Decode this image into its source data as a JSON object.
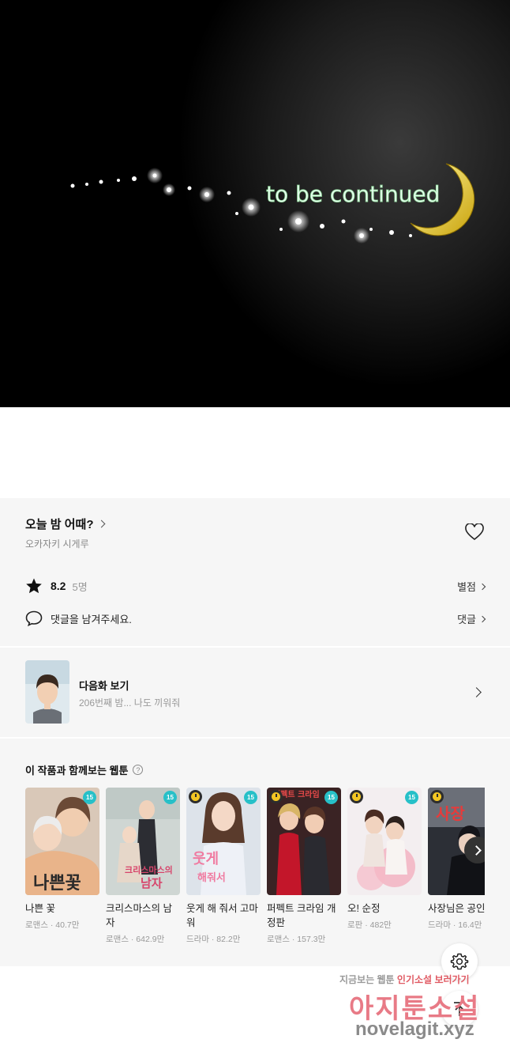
{
  "comic": {
    "caption": "to be continued"
  },
  "work": {
    "title": "오늘 밤 어때?",
    "author": "오카자키 시게루"
  },
  "rating": {
    "score": "8.2",
    "count": "5명",
    "rate_link": "별점"
  },
  "comment": {
    "placeholder": "댓글을 남겨주세요.",
    "link": "댓글"
  },
  "next_episode": {
    "title": "다음화 보기",
    "subtitle": "206번째 밤... 나도 끼워줘"
  },
  "recommend": {
    "title": "이 작품과 함께보는 웹툰",
    "help_glyph": "?",
    "items": [
      {
        "name": "나쁜 꽃",
        "meta": "로맨스 · 40.7만",
        "age": "15",
        "clock": false
      },
      {
        "name": "크리스마스의 남자",
        "meta": "로맨스 · 642.9만",
        "age": "15",
        "clock": false
      },
      {
        "name": "웃게 해 줘서 고마워",
        "meta": "드라마 · 82.2만",
        "age": "15",
        "clock": true
      },
      {
        "name": "퍼펙트 크라임 개정판",
        "meta": "로맨스 · 157.3만",
        "age": "15",
        "clock": true
      },
      {
        "name": "오! 순정",
        "meta": "로판 · 482만",
        "age": "15",
        "clock": true
      },
      {
        "name": "사장님은 공인",
        "meta": "드라마 · 16.4만",
        "age": "",
        "clock": true
      }
    ]
  },
  "watermark": {
    "line1_a": "지금보는 웹툰",
    "line1_b": "인기소설",
    "line1_c": "보러가기",
    "main": "아지툰소설",
    "url": "novelagit.xyz"
  },
  "colors": {
    "accent_age_badge": "#27c0c8",
    "clock_badge": "#f3c623",
    "panel_bg": "#f6f6f6"
  }
}
